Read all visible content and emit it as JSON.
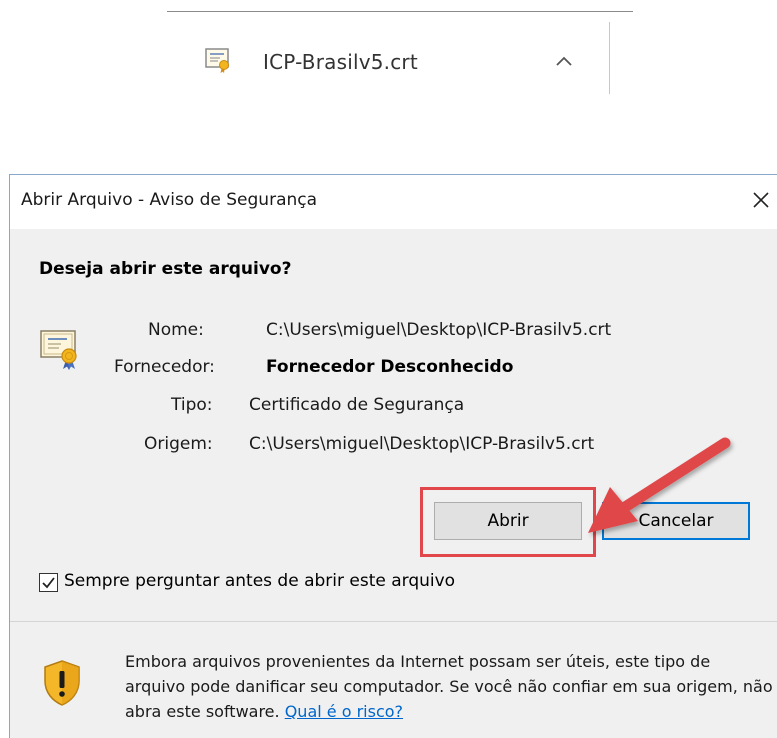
{
  "download_bar": {
    "file_name": "ICP-Brasilv5.crt",
    "file_icon": "certificate-file-icon",
    "expand_icon": "chevron-up-icon"
  },
  "dialog": {
    "title": "Abrir Arquivo - Aviso de Segurança",
    "close_icon": "close-icon",
    "question": "Deseja abrir este arquivo?",
    "cert_icon": "certificate-icon",
    "fields": {
      "name_label": "Nome:",
      "name_value": "C:\\Users\\miguel\\Desktop\\ICP-Brasilv5.crt",
      "publisher_label": "Fornecedor:",
      "publisher_value": "Fornecedor Desconhecido",
      "type_label": "Tipo:",
      "type_value": "Certificado de Segurança",
      "origin_label": "Origem:",
      "origin_value": "C:\\Users\\miguel\\Desktop\\ICP-Brasilv5.crt"
    },
    "buttons": {
      "open_label": "Abrir",
      "cancel_label": "Cancelar"
    },
    "checkbox": {
      "label": "Sempre perguntar antes de abrir este arquivo",
      "checked": true
    },
    "warning": {
      "icon": "shield-warning-icon",
      "text": "Embora arquivos provenientes da Internet possam ser úteis, este tipo de arquivo pode danificar seu computador. Se você não confiar em sua origem, não abra este software. ",
      "link_label": "Qual é o risco?"
    }
  },
  "annotation": {
    "highlight_color": "#e0464a",
    "arrow_color": "#e0464a"
  }
}
